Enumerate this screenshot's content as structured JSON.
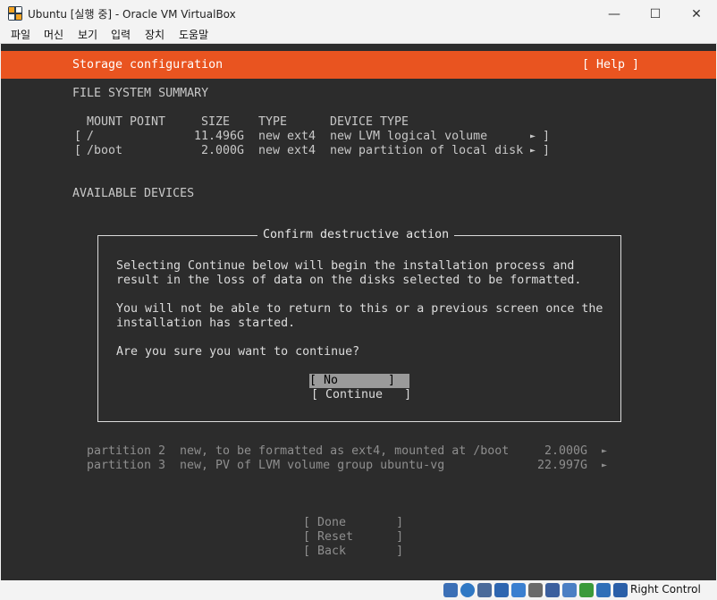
{
  "window": {
    "title": "Ubuntu [실행 중] - Oracle VM VirtualBox",
    "minimize": "—",
    "maximize": "☐",
    "close": "✕"
  },
  "menu": [
    "파일",
    "머신",
    "보기",
    "입력",
    "장치",
    "도움말"
  ],
  "installer": {
    "header_title": "Storage configuration",
    "help": "[ Help ]",
    "fs_summary_heading": "FILE SYSTEM SUMMARY",
    "fs_columns": {
      "mount_point": "MOUNT POINT",
      "size": "SIZE",
      "type": "TYPE",
      "device_type": "DEVICE TYPE"
    },
    "fs_rows": [
      {
        "open": "[",
        "mount": "/",
        "size": "11.496G",
        "type": "new ext4",
        "device": "new LVM logical volume",
        "arrow": "►",
        "close": "]"
      },
      {
        "open": "[",
        "mount": "/boot",
        "size": "2.000G",
        "type": "new ext4",
        "device": "new partition of local disk",
        "arrow": "►",
        "close": "]"
      }
    ],
    "available_heading": "AVAILABLE DEVICES",
    "partitions": [
      {
        "name": "partition 2",
        "desc": "new, to be formatted as ext4, mounted at /boot",
        "size": "2.000G",
        "arrow": "►"
      },
      {
        "name": "partition 3",
        "desc": "new, PV of LVM volume group ubuntu-vg",
        "size": "22.997G",
        "arrow": "►"
      }
    ],
    "actions": {
      "done": "[ Done       ]",
      "reset": "[ Reset      ]",
      "back": "[ Back       ]"
    }
  },
  "dialog": {
    "title": "Confirm destructive action",
    "line1": "Selecting Continue below will begin the installation process and",
    "line2": "result in the loss of data on the disks selected to be formatted.",
    "line3": "You will not be able to return to this or a previous screen once the",
    "line4": "installation has started.",
    "line5": "Are you sure you want to continue?",
    "no_button": "[ No       ]",
    "continue_button": "[ Continue   ]"
  },
  "statusbar": {
    "host_key": "Right Control",
    "icons": [
      "hard-disk-icon",
      "optical-disk-icon",
      "audio-icon",
      "network-icon",
      "usb-icon",
      "shared-folder-icon",
      "display-icon",
      "recording-icon",
      "cpu-icon",
      "mouse-integration-icon",
      "keyboard-capture-icon"
    ]
  }
}
